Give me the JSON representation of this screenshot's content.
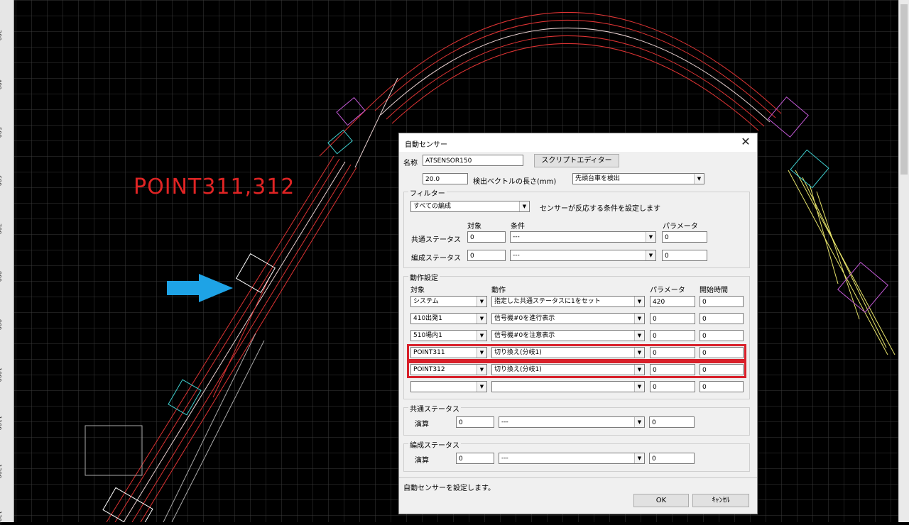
{
  "canvas": {
    "ruler_ticks": [
      "300",
      "400",
      "500",
      "600",
      "700",
      "800",
      "900",
      "1000",
      "1100",
      "1200",
      "1300"
    ],
    "point_label": "POINT311,312",
    "arrow_color": "#1ea3e6"
  },
  "dialog": {
    "title": "自動センサー",
    "name_label": "名称",
    "name_value": "ATSENSOR150",
    "script_editor_button": "スクリプトエディター",
    "vector_length_value": "20.0",
    "vector_length_label": "検出ベクトルの長さ(mm)",
    "detect_mode": "先頭台車を検出",
    "filter": {
      "title": "フィルター",
      "scope": "すべての編成",
      "description": "センサーが反応する条件を設定します",
      "col_target": "対象",
      "col_condition": "条件",
      "col_param": "パラメータ",
      "rows": [
        {
          "label": "共通ステータス",
          "target": "0",
          "condition": "---",
          "param": "0"
        },
        {
          "label": "編成ステータス",
          "target": "0",
          "condition": "---",
          "param": "0"
        }
      ]
    },
    "action": {
      "title": "動作設定",
      "col_target": "対象",
      "col_action": "動作",
      "col_param": "パラメータ",
      "col_start": "開始時間",
      "rows": [
        {
          "target": "システム",
          "action": "指定した共通ステータスに1をセット",
          "param": "420",
          "start": "0"
        },
        {
          "target": "410出発1",
          "action": "信号機#0を進行表示",
          "param": "0",
          "start": "0"
        },
        {
          "target": "510場内1",
          "action": "信号機#0を注意表示",
          "param": "0",
          "start": "0"
        },
        {
          "target": "POINT311",
          "action": "切り換え(分岐1)",
          "param": "0",
          "start": "0"
        },
        {
          "target": "POINT312",
          "action": "切り換え(分岐1)",
          "param": "0",
          "start": "0"
        },
        {
          "target": "",
          "action": "",
          "param": "0",
          "start": "0"
        }
      ]
    },
    "common_status": {
      "title": "共通ステータス",
      "op_label": "演算",
      "value1": "0",
      "op": "---",
      "value2": "0"
    },
    "train_status": {
      "title": "編成ステータス",
      "op_label": "演算",
      "value1": "0",
      "op": "---",
      "value2": "0"
    },
    "status_text": "自動センサーを設定します。",
    "ok_button": "OK",
    "cancel_button": "ｷｬﾝｾﾙ"
  }
}
